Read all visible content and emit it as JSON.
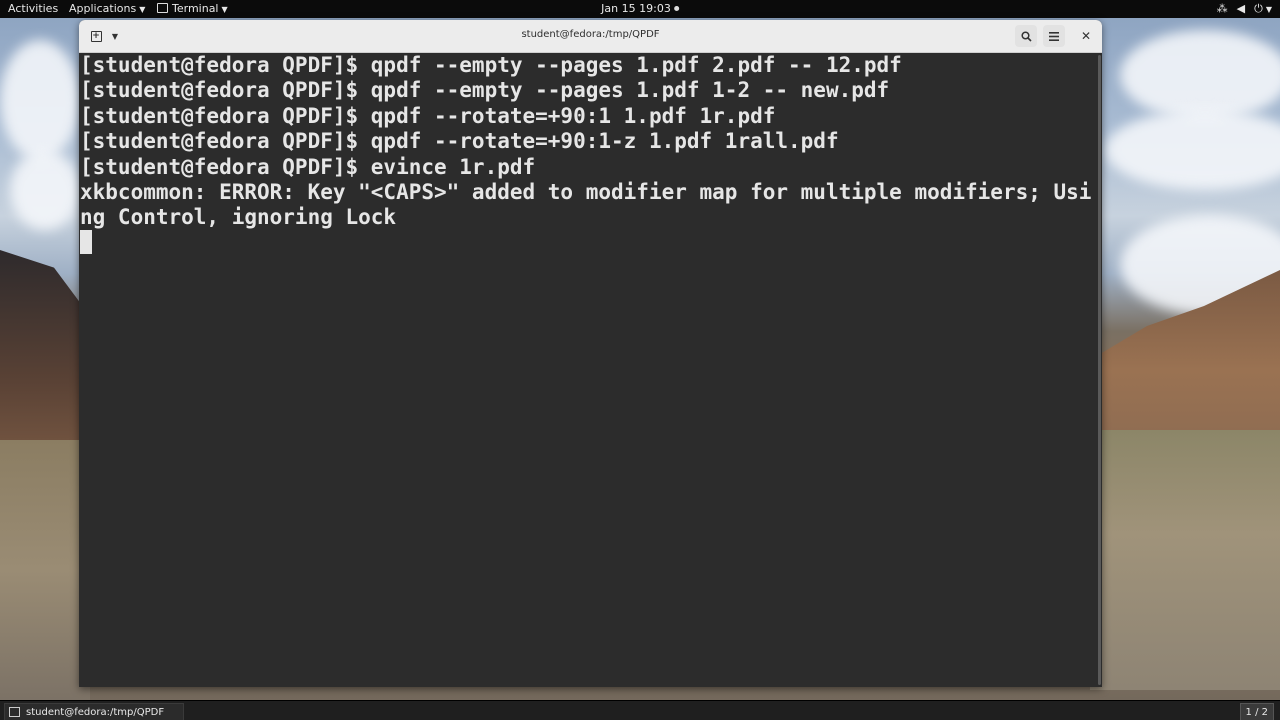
{
  "topbar": {
    "activities": "Activities",
    "applications": "Applications",
    "terminal_app": "Terminal",
    "clock": "Jan 15  19:03",
    "icons": [
      "network-icon",
      "volume-icon",
      "power-icon"
    ]
  },
  "window": {
    "title": "student@fedora:/tmp/QPDF",
    "icons": [
      "new-tab-icon",
      "chevron-down-icon",
      "search-icon",
      "hamburger-menu-icon",
      "close-icon"
    ]
  },
  "terminal": {
    "lines": [
      "[student@fedora QPDF]$ qpdf --empty --pages 1.pdf 2.pdf -- 12.pdf",
      "[student@fedora QPDF]$ qpdf --empty --pages 1.pdf 1-2 -- new.pdf",
      "[student@fedora QPDF]$ qpdf --rotate=+90:1 1.pdf 1r.pdf",
      "[student@fedora QPDF]$ qpdf --rotate=+90:1-z 1.pdf 1rall.pdf",
      "[student@fedora QPDF]$ evince 1r.pdf",
      "xkbcommon: ERROR: Key \"<CAPS>\" added to modifier map for multiple modifiers; Usi",
      "ng Control, ignoring Lock"
    ]
  },
  "bottombar": {
    "task_label": "student@fedora:/tmp/QPDF",
    "workspace": "1 / 2"
  }
}
